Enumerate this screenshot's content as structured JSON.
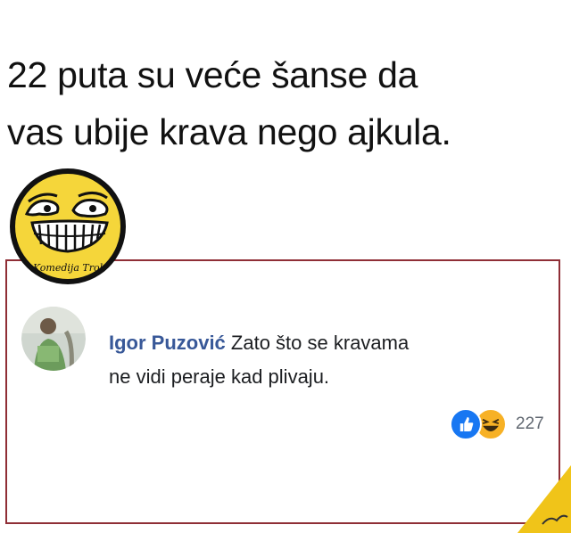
{
  "post": {
    "headline_line1": "22 puta su veće šanse da",
    "headline_line2": "vas ubije krava  nego ajkula."
  },
  "logo": {
    "icon": "troll-face-icon",
    "text": "Komedija Trol"
  },
  "comment": {
    "author": "Igor Puzović",
    "text_line1": "Zato što se kravama",
    "text_line2": "ne vidi peraje kad plivaju."
  },
  "reactions": {
    "icons": [
      "like-icon",
      "haha-icon"
    ],
    "count": "227"
  },
  "colors": {
    "frame_border": "#8f2e36",
    "author_link": "#385898",
    "like_blue": "#1877f2",
    "haha_yellow": "#f7b125",
    "logo_yellow": "#f5d63a"
  }
}
